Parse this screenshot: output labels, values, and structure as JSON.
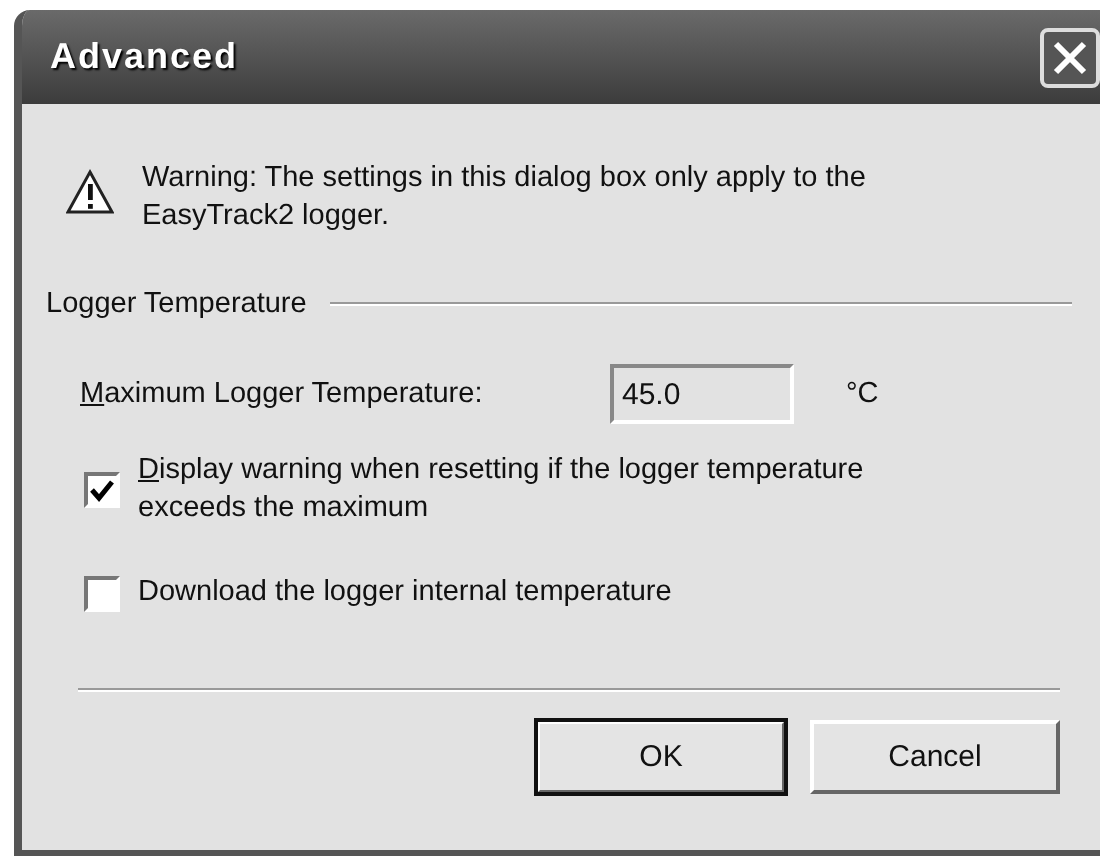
{
  "window": {
    "title": "Advanced"
  },
  "warning": {
    "text": "Warning: The settings in this dialog box only apply to the EasyTrack2 logger."
  },
  "group": {
    "title": "Logger Temperature"
  },
  "max_temperature": {
    "label": "Maximum Logger Temperature:",
    "mnemonic_underlined": true,
    "value": "45.0",
    "unit": "°C",
    "disabled": true
  },
  "checkboxes": [
    {
      "label": "Display warning when resetting if the logger temperature exceeds the maximum",
      "checked": true,
      "mnemonic_underlined": true
    },
    {
      "label": "Download the logger internal temperature",
      "checked": false,
      "mnemonic_underlined": false
    }
  ],
  "buttons": [
    {
      "label": "OK",
      "default": true
    },
    {
      "label": "Cancel",
      "default": false
    }
  ]
}
